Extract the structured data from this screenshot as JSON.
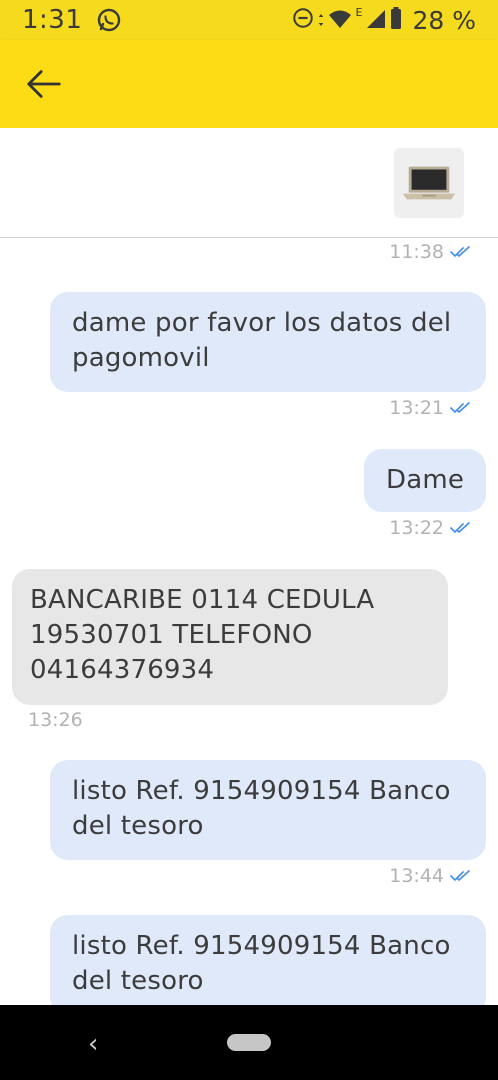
{
  "status_bar": {
    "time": "1:31",
    "battery_percent": "28 %",
    "network_label": "E"
  },
  "app_bar": {
    "back_icon": "arrow-left-icon"
  },
  "messages": [
    {
      "direction": "out",
      "text": "",
      "time": "11:38",
      "status": "read"
    },
    {
      "direction": "out",
      "text": "dame por favor los datos del pagomovil",
      "time": "13:21",
      "status": "read"
    },
    {
      "direction": "out",
      "text": "Dame",
      "time": "13:22",
      "status": "read"
    },
    {
      "direction": "in",
      "text": "BANCARIBE 0114 CEDULA 19530701 TELEFONO 04164376934",
      "time": "13:26"
    },
    {
      "direction": "out",
      "text": "listo Ref. 9154909154 Banco del tesoro",
      "time": "13:44",
      "status": "read"
    },
    {
      "direction": "out",
      "text": "listo Ref. 9154909154 Banco del tesoro",
      "time": "",
      "status": ""
    }
  ],
  "nav_bar": {
    "back_glyph": "‹"
  },
  "colors": {
    "accent_yellow": "#fcdc14",
    "outgoing_bubble": "#dfe9fa",
    "incoming_bubble": "#e7e7e7",
    "read_check": "#4a90e2"
  }
}
